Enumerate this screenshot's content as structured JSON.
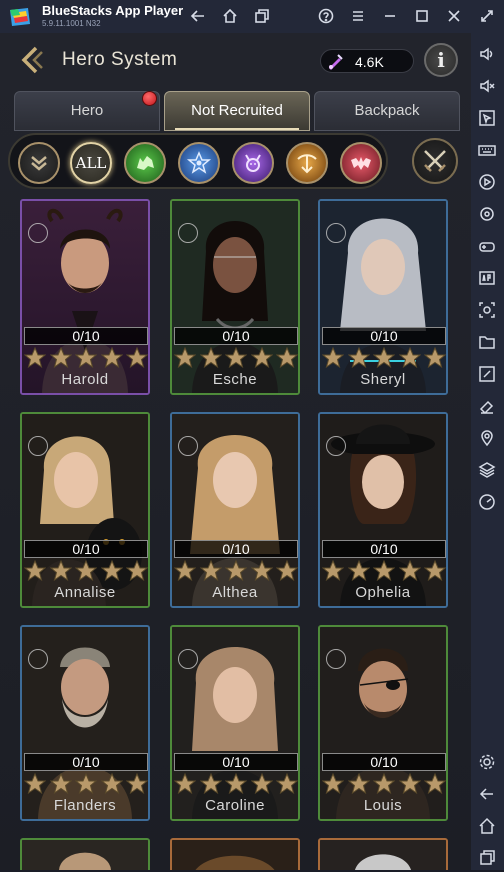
{
  "window": {
    "app_title": "BlueStacks App Player",
    "version": "5.9.11.1001 N32"
  },
  "header": {
    "title": "Hero System",
    "currency_value": "4.6K",
    "info_label": "i"
  },
  "tabs": [
    {
      "label": "Hero",
      "active": false,
      "has_notification": true
    },
    {
      "label": "Not Recruited",
      "active": true,
      "has_notification": false
    },
    {
      "label": "Backpack",
      "active": false,
      "has_notification": false
    }
  ],
  "filters": {
    "all_label": "ALL",
    "items": [
      {
        "icon": "collapse-chevrons-icon",
        "color": "#c8b896"
      },
      {
        "icon": "all-filter",
        "color": "#d8c898"
      },
      {
        "icon": "wolf-faction-icon",
        "color": "#3fa83a"
      },
      {
        "icon": "eye-star-faction-icon",
        "color": "#3a78c8"
      },
      {
        "icon": "demon-faction-icon",
        "color": "#8a48c8"
      },
      {
        "icon": "crossbow-faction-icon",
        "color": "#c88a2a"
      },
      {
        "icon": "bat-faction-icon",
        "color": "#c83a4a"
      }
    ]
  },
  "heroes": [
    {
      "name": "Harold",
      "progress": "0/10",
      "rarity": "purple",
      "stars": 5
    },
    {
      "name": "Esche",
      "progress": "0/10",
      "rarity": "green",
      "stars": 5
    },
    {
      "name": "Sheryl",
      "progress": "0/10",
      "rarity": "blue",
      "stars": 5
    },
    {
      "name": "Annalise",
      "progress": "0/10",
      "rarity": "green",
      "stars": 5
    },
    {
      "name": "Althea",
      "progress": "0/10",
      "rarity": "blue",
      "stars": 5
    },
    {
      "name": "Ophelia",
      "progress": "0/10",
      "rarity": "blue",
      "stars": 5
    },
    {
      "name": "Flanders",
      "progress": "0/10",
      "rarity": "blue",
      "stars": 5
    },
    {
      "name": "Caroline",
      "progress": "0/10",
      "rarity": "green",
      "stars": 5
    },
    {
      "name": "Louis",
      "progress": "0/10",
      "rarity": "green",
      "stars": 5
    }
  ],
  "colors": {
    "accent_gold": "#c9b07a",
    "notification_red": "#d0202a",
    "purple_rarity": "#7a4fa8",
    "green_rarity": "#4e8a3a",
    "blue_rarity": "#3e6c98"
  }
}
